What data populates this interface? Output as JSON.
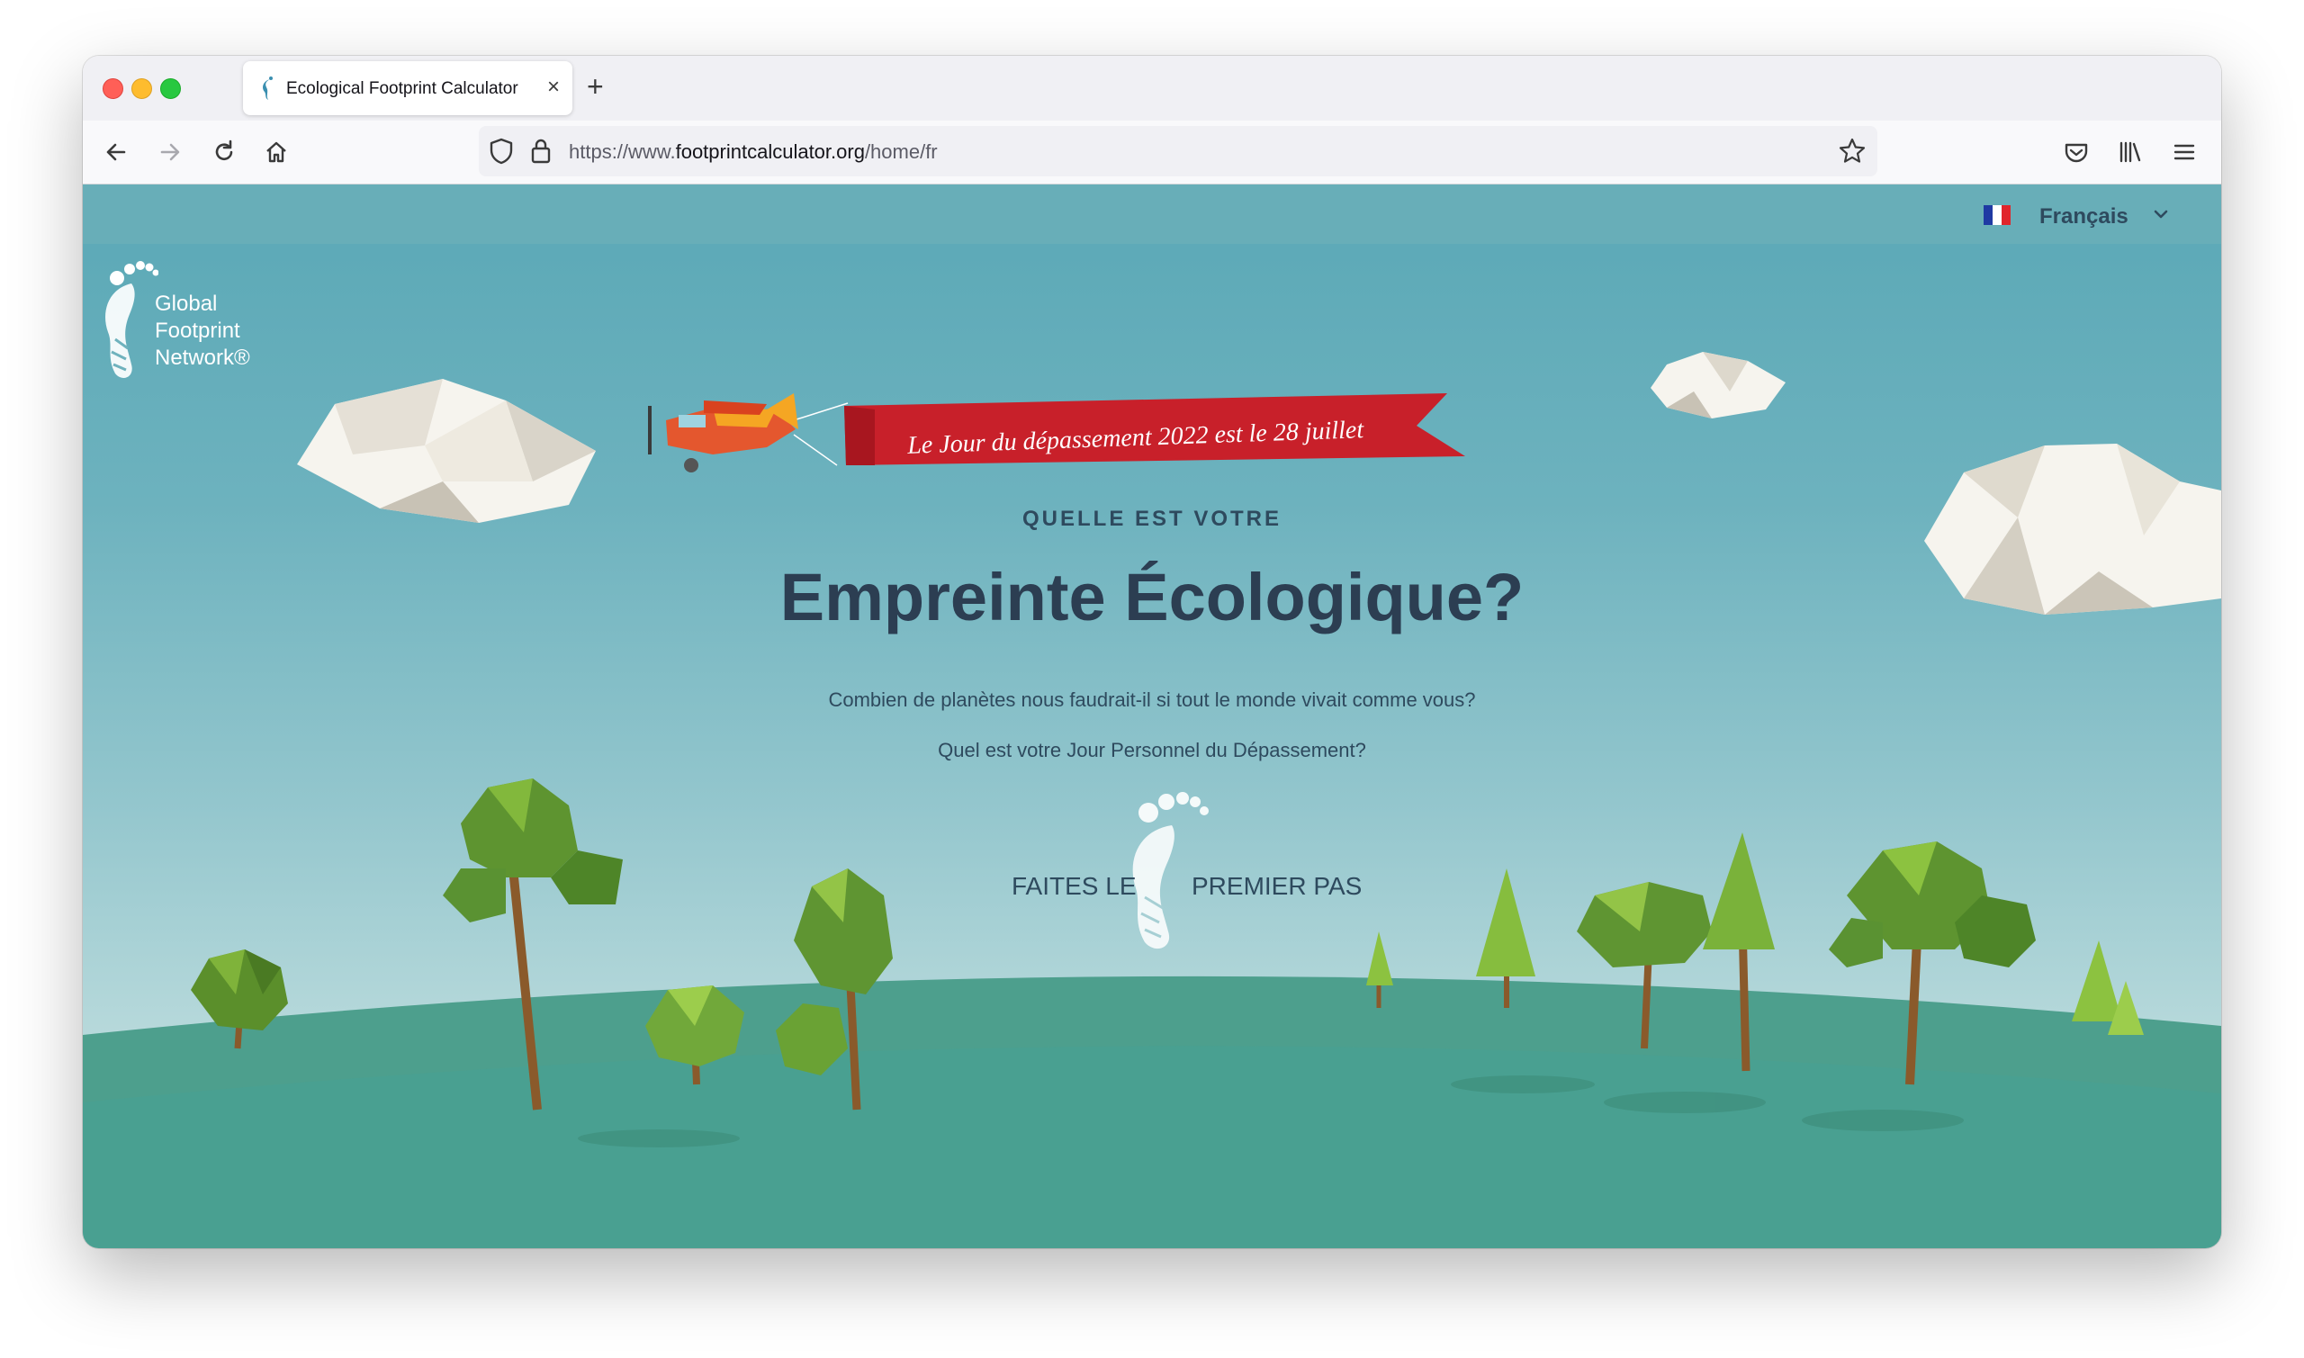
{
  "browser": {
    "tab_title": "Ecological Footprint Calculator",
    "new_tab_label": "+",
    "close_label": "×",
    "url_prefix": "https://www.",
    "url_domain": "footprintcalculator.org",
    "url_path": "/home/fr"
  },
  "page": {
    "language": "Français",
    "logo_lines": [
      "Global",
      "Footprint",
      "Network®"
    ],
    "banner": "Le Jour du dépassement 2022 est le 28 juillet",
    "subtitle": "QUELLE EST VOTRE",
    "title": "Empreinte Écologique?",
    "question1": "Combien de planètes nous faudrait-il si tout le monde vivait comme vous?",
    "question2": "Quel est votre Jour Personnel du Dépassement?",
    "cta_left": "FAITES LE",
    "cta_right": "PREMIER PAS"
  },
  "icons": {
    "back": "back-arrow-icon",
    "forward": "forward-arrow-icon",
    "reload": "reload-icon",
    "home": "home-icon",
    "shield": "shield-icon",
    "lock": "lock-icon",
    "bookmark": "star-icon",
    "pocket": "pocket-icon",
    "library": "library-icon",
    "menu": "hamburger-menu-icon"
  },
  "colors": {
    "sky_top": "#5aa8b6",
    "sky_bottom": "#bfdcdc",
    "grass": "#4da08e",
    "banner_red": "#c8202a",
    "title_text": "#2c3e52",
    "plane_orange": "#f5a623"
  }
}
